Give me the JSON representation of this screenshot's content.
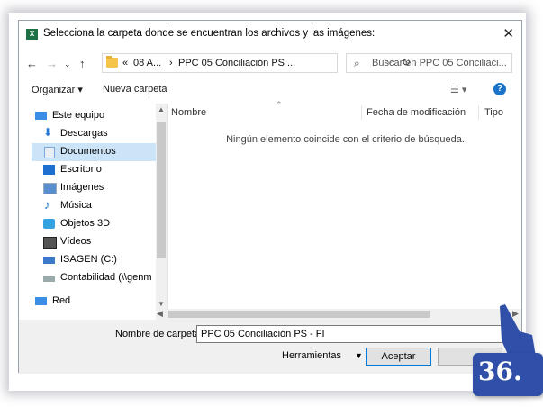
{
  "window": {
    "title": "Selecciona la carpeta donde se encuentran los archivos y las imágenes:",
    "app_icon_text": "X",
    "close_icon": "close-icon"
  },
  "address": {
    "crumbs": [
      "«",
      "08 A...",
      "›",
      "PPC 05 Conciliación PS ..."
    ],
    "search_placeholder": "Buscar en PPC 05 Conciliaci..."
  },
  "toolbar": {
    "organize_label": "Organizar ▾",
    "new_folder_label": "Nueva carpeta"
  },
  "nav": {
    "items": [
      {
        "label": "Este equipo",
        "icon": "pc-icon",
        "color": "#3a8ee6"
      },
      {
        "label": "Descargas",
        "icon": "download-icon",
        "color": "#2a7ad5"
      },
      {
        "label": "Documentos",
        "icon": "documents-icon",
        "color": "#7aa7d8"
      },
      {
        "label": "Escritorio",
        "icon": "desktop-icon",
        "color": "#1e6fd0"
      },
      {
        "label": "Imágenes",
        "icon": "pictures-icon",
        "color": "#5a8fcf"
      },
      {
        "label": "Música",
        "icon": "music-icon",
        "color": "#1a73c8"
      },
      {
        "label": "Objetos 3D",
        "icon": "objects3d-icon",
        "color": "#35a3e0"
      },
      {
        "label": "Vídeos",
        "icon": "videos-icon",
        "color": "#555555"
      },
      {
        "label": "ISAGEN (C:)",
        "icon": "drive-icon",
        "color": "#3b7ac9"
      },
      {
        "label": "Contabilidad (\\\\genm",
        "icon": "network-drive-icon",
        "color": "#c0392b"
      },
      {
        "label": "Red",
        "icon": "network-icon",
        "color": "#3a8ee6"
      }
    ]
  },
  "columns": {
    "name": "Nombre",
    "modified": "Fecha de modificación",
    "type": "Tipo"
  },
  "empty_message": "Ningún elemento coincide con el criterio de búsqueda.",
  "footer": {
    "folder_name_label": "Nombre de carpeta:",
    "folder_name_value": "PPC 05 Conciliación PS - FI",
    "tools_label": "Herramientas",
    "ok_label": "Aceptar"
  },
  "badge": {
    "number": "36.",
    "color": "#2f4fa8"
  }
}
